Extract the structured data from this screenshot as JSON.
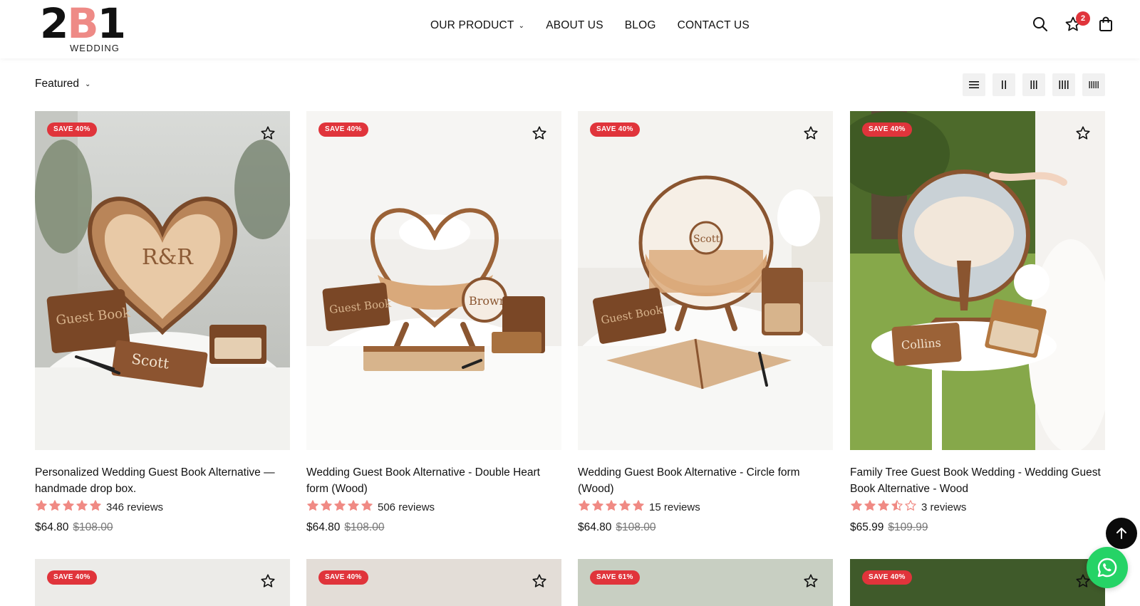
{
  "brand": {
    "logo_number": "2",
    "logo_b": "B",
    "logo_one": "1",
    "logo_sub": "WEDDING"
  },
  "nav": {
    "items": [
      {
        "label": "OUR PRODUCT",
        "has_dropdown": true
      },
      {
        "label": "ABOUT US"
      },
      {
        "label": "BLOG"
      },
      {
        "label": "CONTACT US"
      }
    ]
  },
  "header_icons": {
    "search": "search-icon",
    "wishlist": "star-icon",
    "wishlist_count": "2",
    "cart": "bag-icon"
  },
  "toolbar": {
    "sort_label": "Featured",
    "view_modes": [
      "list",
      "2-col",
      "3-col",
      "4-col",
      "5-col"
    ]
  },
  "products": [
    {
      "badge": "SAVE 40%",
      "title": "Personalized Wedding Guest Book Alternative — handmade drop box.",
      "rating": 5,
      "reviews": "346 reviews",
      "price": "$64.80",
      "compare": "$108.00",
      "scene": "heart"
    },
    {
      "badge": "SAVE 40%",
      "title": "Wedding Guest Book Alternative - Double Heart form (Wood)",
      "rating": 5,
      "reviews": "506 reviews",
      "price": "$64.80",
      "compare": "$108.00",
      "scene": "heart-white"
    },
    {
      "badge": "SAVE 40%",
      "title": "Wedding Guest Book Alternative - Circle form (Wood)",
      "rating": 5,
      "reviews": "15 reviews",
      "price": "$64.80",
      "compare": "$108.00",
      "scene": "circle"
    },
    {
      "badge": "SAVE 40%",
      "title": "Family Tree Guest Book Wedding - Wedding Guest Book Alternative - Wood",
      "rating": 3.5,
      "reviews": "3 reviews",
      "price": "$65.99",
      "compare": "$109.99",
      "scene": "tree"
    }
  ],
  "products_row2": [
    {
      "badge": "SAVE 40%"
    },
    {
      "badge": "SAVE 40%"
    },
    {
      "badge": "SAVE 61%"
    },
    {
      "badge": "SAVE 40%"
    }
  ],
  "colors": {
    "accent": "#e0343b",
    "star": "#f08a84",
    "brand_pink": "#ee8a86",
    "whatsapp": "#25d366"
  }
}
